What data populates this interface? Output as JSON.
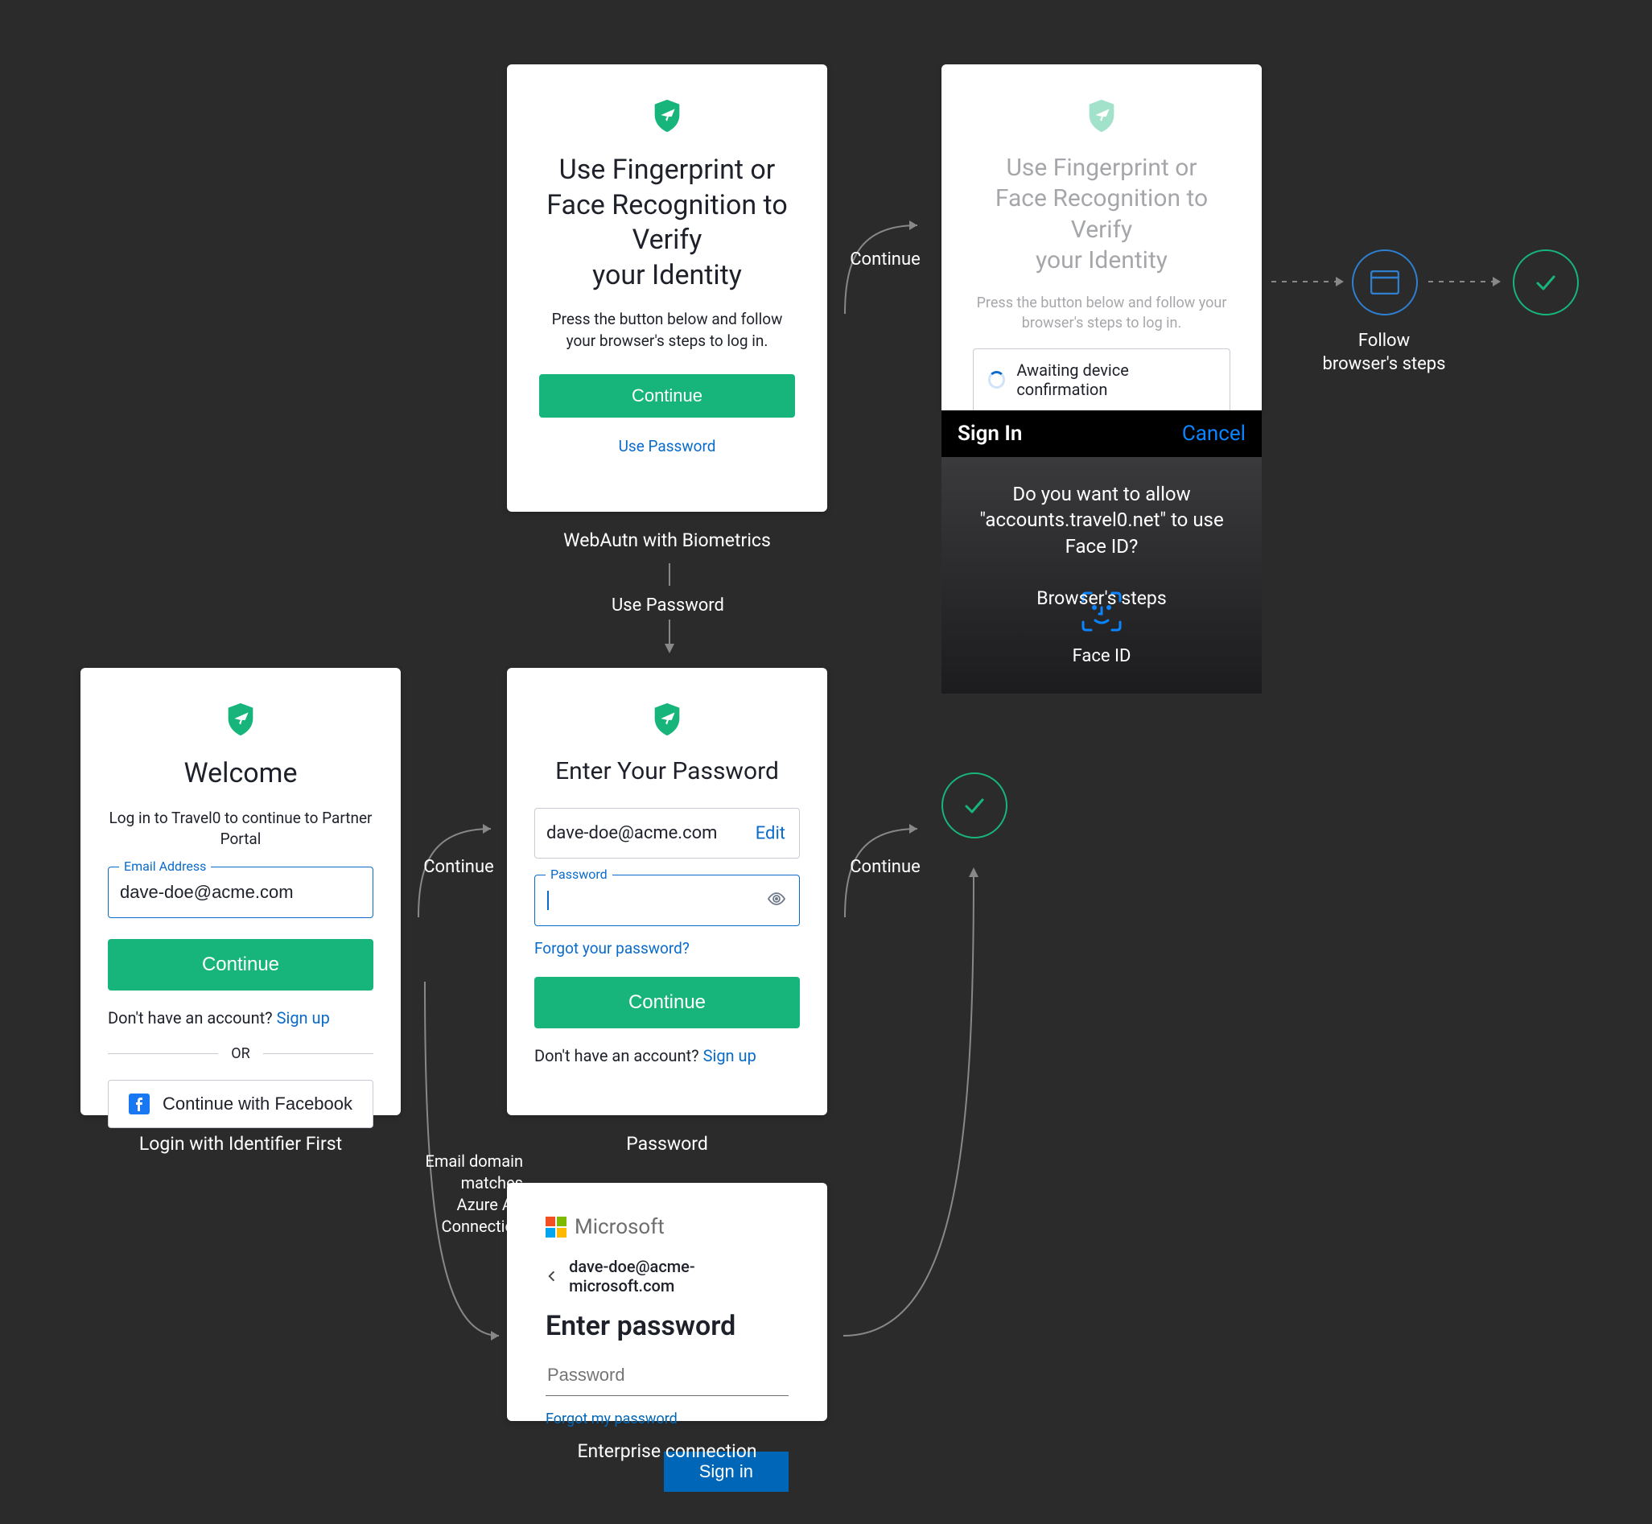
{
  "accent_green": "#17b57b",
  "accent_blue": "#0a6bcb",
  "ms_blue": "#0067b8",
  "ios_blue": "#0a84ff",
  "webautn": {
    "title_line1": "Use Fingerprint or",
    "title_line2": "Face Recognition to Verify",
    "title_line3": "your Identity",
    "subtitle": "Press the button below and follow your browser's steps to log in.",
    "continue": "Continue",
    "use_password": "Use Password",
    "caption": "WebAutn with Biometrics"
  },
  "browser_steps": {
    "awaiting": "Awaiting device confirmation",
    "sign_in": "Sign In",
    "cancel": "Cancel",
    "ask_line": "Do you want to allow \"accounts.travel0.net\" to use Face ID?",
    "faceid_label": "Face ID",
    "caption": "Browser's steps"
  },
  "flow": {
    "continue1": "Continue",
    "use_password": "Use Password",
    "continue2": "Continue",
    "continue3": "Continue",
    "enterprise": "Email domain matches Azure AD  Connection",
    "follow_browser": "Follow browser's steps"
  },
  "identifier": {
    "caption": "Login with Identifier First",
    "welcome": "Welcome",
    "subtitle": "Log in to Travel0  to continue to Partner Portal",
    "email_label": "Email Address",
    "email_value": "dave-doe@acme.com",
    "continue": "Continue",
    "no_account": "Don't have an account? ",
    "signup": "Sign up",
    "or": "OR",
    "facebook": "Continue with Facebook"
  },
  "password": {
    "caption": "Password",
    "title": "Enter Your Password",
    "email_value": "dave-doe@acme.com",
    "edit": "Edit",
    "pw_label": "Password",
    "forgot": "Forgot your password?",
    "continue": "Continue",
    "no_account": "Don't have an account? ",
    "signup": "Sign up"
  },
  "enterprise": {
    "caption": "Enterprise connection",
    "ms": "Microsoft",
    "email": "dave-doe@acme-microsoft.com",
    "title": "Enter password",
    "placeholder": "Password",
    "forgot": "Forgot my password",
    "signin": "Sign in"
  }
}
